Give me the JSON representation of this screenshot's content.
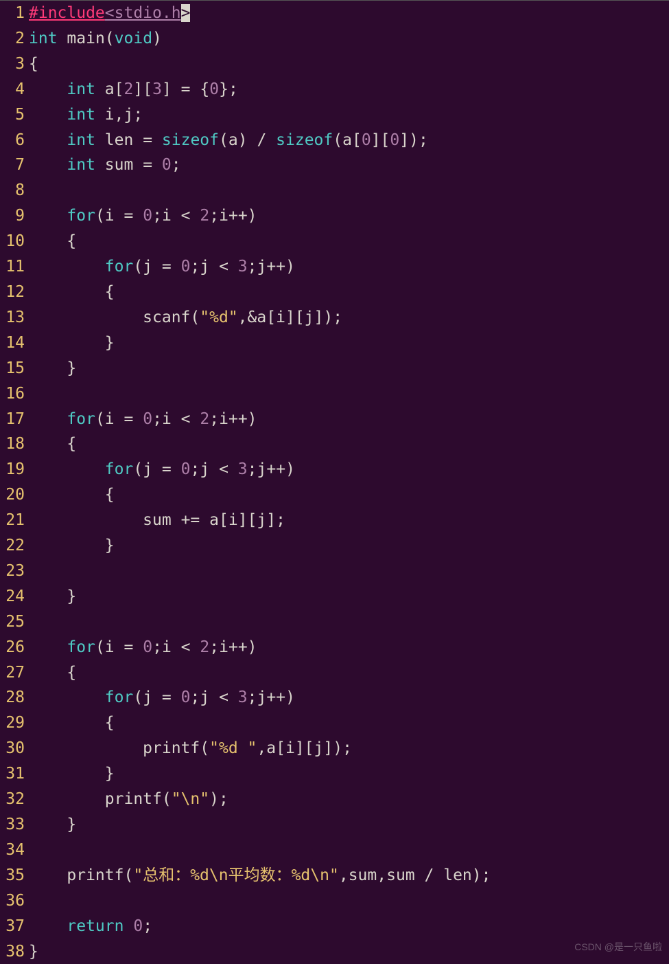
{
  "watermark": "CSDN @是一只鱼啦",
  "lines": [
    {
      "n": "1",
      "tokens": [
        [
          "pp",
          "#include"
        ],
        [
          "inc",
          "<stdio.h"
        ],
        [
          "cursor",
          ">"
        ]
      ]
    },
    {
      "n": "2",
      "tokens": [
        [
          "kw",
          "int"
        ],
        [
          "sp",
          " "
        ],
        [
          "id",
          "main"
        ],
        [
          "paren",
          "("
        ],
        [
          "kw",
          "void"
        ],
        [
          "paren",
          ")"
        ]
      ]
    },
    {
      "n": "3",
      "tokens": [
        [
          "paren",
          "{"
        ]
      ]
    },
    {
      "n": "4",
      "tokens": [
        [
          "indent",
          "    "
        ],
        [
          "kw",
          "int"
        ],
        [
          "sp",
          " "
        ],
        [
          "id",
          "a"
        ],
        [
          "paren",
          "["
        ],
        [
          "num",
          "2"
        ],
        [
          "paren",
          "]["
        ],
        [
          "num",
          "3"
        ],
        [
          "paren",
          "]"
        ],
        [
          "sp",
          " "
        ],
        [
          "op",
          "="
        ],
        [
          "sp",
          " "
        ],
        [
          "paren",
          "{"
        ],
        [
          "num",
          "0"
        ],
        [
          "paren",
          "}"
        ],
        [
          "op",
          ";"
        ]
      ]
    },
    {
      "n": "5",
      "tokens": [
        [
          "indent",
          "    "
        ],
        [
          "kw",
          "int"
        ],
        [
          "sp",
          " "
        ],
        [
          "id",
          "i"
        ],
        [
          "op",
          ","
        ],
        [
          "id",
          "j"
        ],
        [
          "op",
          ";"
        ]
      ]
    },
    {
      "n": "6",
      "tokens": [
        [
          "indent",
          "    "
        ],
        [
          "kw",
          "int"
        ],
        [
          "sp",
          " "
        ],
        [
          "id",
          "len"
        ],
        [
          "sp",
          " "
        ],
        [
          "op",
          "="
        ],
        [
          "sp",
          " "
        ],
        [
          "kw",
          "sizeof"
        ],
        [
          "paren",
          "("
        ],
        [
          "id",
          "a"
        ],
        [
          "paren",
          ")"
        ],
        [
          "sp",
          " "
        ],
        [
          "op",
          "/"
        ],
        [
          "sp",
          " "
        ],
        [
          "kw",
          "sizeof"
        ],
        [
          "paren",
          "("
        ],
        [
          "id",
          "a"
        ],
        [
          "paren",
          "["
        ],
        [
          "num",
          "0"
        ],
        [
          "paren",
          "]["
        ],
        [
          "num",
          "0"
        ],
        [
          "paren",
          "])"
        ],
        [
          "op",
          ";"
        ]
      ]
    },
    {
      "n": "7",
      "tokens": [
        [
          "indent",
          "    "
        ],
        [
          "kw",
          "int"
        ],
        [
          "sp",
          " "
        ],
        [
          "id",
          "sum"
        ],
        [
          "sp",
          " "
        ],
        [
          "op",
          "="
        ],
        [
          "sp",
          " "
        ],
        [
          "num",
          "0"
        ],
        [
          "op",
          ";"
        ]
      ]
    },
    {
      "n": "8",
      "tokens": []
    },
    {
      "n": "9",
      "tokens": [
        [
          "indent",
          "    "
        ],
        [
          "kw",
          "for"
        ],
        [
          "paren",
          "("
        ],
        [
          "id",
          "i"
        ],
        [
          "sp",
          " "
        ],
        [
          "op",
          "="
        ],
        [
          "sp",
          " "
        ],
        [
          "num",
          "0"
        ],
        [
          "op",
          ";"
        ],
        [
          "id",
          "i"
        ],
        [
          "sp",
          " "
        ],
        [
          "op",
          "<"
        ],
        [
          "sp",
          " "
        ],
        [
          "num",
          "2"
        ],
        [
          "op",
          ";"
        ],
        [
          "id",
          "i"
        ],
        [
          "op",
          "++"
        ],
        [
          "paren",
          ")"
        ]
      ]
    },
    {
      "n": "10",
      "tokens": [
        [
          "indent",
          "    "
        ],
        [
          "paren",
          "{"
        ]
      ]
    },
    {
      "n": "11",
      "tokens": [
        [
          "indent",
          "        "
        ],
        [
          "kw",
          "for"
        ],
        [
          "paren",
          "("
        ],
        [
          "id",
          "j"
        ],
        [
          "sp",
          " "
        ],
        [
          "op",
          "="
        ],
        [
          "sp",
          " "
        ],
        [
          "num",
          "0"
        ],
        [
          "op",
          ";"
        ],
        [
          "id",
          "j"
        ],
        [
          "sp",
          " "
        ],
        [
          "op",
          "<"
        ],
        [
          "sp",
          " "
        ],
        [
          "num",
          "3"
        ],
        [
          "op",
          ";"
        ],
        [
          "id",
          "j"
        ],
        [
          "op",
          "++"
        ],
        [
          "paren",
          ")"
        ]
      ]
    },
    {
      "n": "12",
      "tokens": [
        [
          "indent",
          "        "
        ],
        [
          "paren",
          "{"
        ]
      ]
    },
    {
      "n": "13",
      "tokens": [
        [
          "indent",
          "            "
        ],
        [
          "id",
          "scanf"
        ],
        [
          "paren",
          "("
        ],
        [
          "str",
          "\"%d\""
        ],
        [
          "op",
          ","
        ],
        [
          "op",
          "&"
        ],
        [
          "id",
          "a"
        ],
        [
          "paren",
          "["
        ],
        [
          "id",
          "i"
        ],
        [
          "paren",
          "]["
        ],
        [
          "id",
          "j"
        ],
        [
          "paren",
          "])"
        ],
        [
          "op",
          ";"
        ]
      ]
    },
    {
      "n": "14",
      "tokens": [
        [
          "indent",
          "        "
        ],
        [
          "paren",
          "}"
        ]
      ]
    },
    {
      "n": "15",
      "tokens": [
        [
          "indent",
          "    "
        ],
        [
          "paren",
          "}"
        ]
      ]
    },
    {
      "n": "16",
      "tokens": []
    },
    {
      "n": "17",
      "tokens": [
        [
          "indent",
          "    "
        ],
        [
          "kw",
          "for"
        ],
        [
          "paren",
          "("
        ],
        [
          "id",
          "i"
        ],
        [
          "sp",
          " "
        ],
        [
          "op",
          "="
        ],
        [
          "sp",
          " "
        ],
        [
          "num",
          "0"
        ],
        [
          "op",
          ";"
        ],
        [
          "id",
          "i"
        ],
        [
          "sp",
          " "
        ],
        [
          "op",
          "<"
        ],
        [
          "sp",
          " "
        ],
        [
          "num",
          "2"
        ],
        [
          "op",
          ";"
        ],
        [
          "id",
          "i"
        ],
        [
          "op",
          "++"
        ],
        [
          "paren",
          ")"
        ]
      ]
    },
    {
      "n": "18",
      "tokens": [
        [
          "indent",
          "    "
        ],
        [
          "paren",
          "{"
        ]
      ]
    },
    {
      "n": "19",
      "tokens": [
        [
          "indent",
          "        "
        ],
        [
          "kw",
          "for"
        ],
        [
          "paren",
          "("
        ],
        [
          "id",
          "j"
        ],
        [
          "sp",
          " "
        ],
        [
          "op",
          "="
        ],
        [
          "sp",
          " "
        ],
        [
          "num",
          "0"
        ],
        [
          "op",
          ";"
        ],
        [
          "id",
          "j"
        ],
        [
          "sp",
          " "
        ],
        [
          "op",
          "<"
        ],
        [
          "sp",
          " "
        ],
        [
          "num",
          "3"
        ],
        [
          "op",
          ";"
        ],
        [
          "id",
          "j"
        ],
        [
          "op",
          "++"
        ],
        [
          "paren",
          ")"
        ]
      ]
    },
    {
      "n": "20",
      "tokens": [
        [
          "indent",
          "        "
        ],
        [
          "paren",
          "{"
        ]
      ]
    },
    {
      "n": "21",
      "tokens": [
        [
          "indent",
          "            "
        ],
        [
          "id",
          "sum"
        ],
        [
          "sp",
          " "
        ],
        [
          "op",
          "+="
        ],
        [
          "sp",
          " "
        ],
        [
          "id",
          "a"
        ],
        [
          "paren",
          "["
        ],
        [
          "id",
          "i"
        ],
        [
          "paren",
          "]["
        ],
        [
          "id",
          "j"
        ],
        [
          "paren",
          "]"
        ],
        [
          "op",
          ";"
        ]
      ]
    },
    {
      "n": "22",
      "tokens": [
        [
          "indent",
          "        "
        ],
        [
          "paren",
          "}"
        ]
      ]
    },
    {
      "n": "23",
      "tokens": []
    },
    {
      "n": "24",
      "tokens": [
        [
          "indent",
          "    "
        ],
        [
          "paren",
          "}"
        ]
      ]
    },
    {
      "n": "25",
      "tokens": []
    },
    {
      "n": "26",
      "tokens": [
        [
          "indent",
          "    "
        ],
        [
          "kw",
          "for"
        ],
        [
          "paren",
          "("
        ],
        [
          "id",
          "i"
        ],
        [
          "sp",
          " "
        ],
        [
          "op",
          "="
        ],
        [
          "sp",
          " "
        ],
        [
          "num",
          "0"
        ],
        [
          "op",
          ";"
        ],
        [
          "id",
          "i"
        ],
        [
          "sp",
          " "
        ],
        [
          "op",
          "<"
        ],
        [
          "sp",
          " "
        ],
        [
          "num",
          "2"
        ],
        [
          "op",
          ";"
        ],
        [
          "id",
          "i"
        ],
        [
          "op",
          "++"
        ],
        [
          "paren",
          ")"
        ]
      ]
    },
    {
      "n": "27",
      "tokens": [
        [
          "indent",
          "    "
        ],
        [
          "paren",
          "{"
        ]
      ]
    },
    {
      "n": "28",
      "tokens": [
        [
          "indent",
          "        "
        ],
        [
          "kw",
          "for"
        ],
        [
          "paren",
          "("
        ],
        [
          "id",
          "j"
        ],
        [
          "sp",
          " "
        ],
        [
          "op",
          "="
        ],
        [
          "sp",
          " "
        ],
        [
          "num",
          "0"
        ],
        [
          "op",
          ";"
        ],
        [
          "id",
          "j"
        ],
        [
          "sp",
          " "
        ],
        [
          "op",
          "<"
        ],
        [
          "sp",
          " "
        ],
        [
          "num",
          "3"
        ],
        [
          "op",
          ";"
        ],
        [
          "id",
          "j"
        ],
        [
          "op",
          "++"
        ],
        [
          "paren",
          ")"
        ]
      ]
    },
    {
      "n": "29",
      "tokens": [
        [
          "indent",
          "        "
        ],
        [
          "paren",
          "{"
        ]
      ]
    },
    {
      "n": "30",
      "tokens": [
        [
          "indent",
          "            "
        ],
        [
          "id",
          "printf"
        ],
        [
          "paren",
          "("
        ],
        [
          "str",
          "\"%d \""
        ],
        [
          "op",
          ","
        ],
        [
          "id",
          "a"
        ],
        [
          "paren",
          "["
        ],
        [
          "id",
          "i"
        ],
        [
          "paren",
          "]["
        ],
        [
          "id",
          "j"
        ],
        [
          "paren",
          "])"
        ],
        [
          "op",
          ";"
        ]
      ]
    },
    {
      "n": "31",
      "tokens": [
        [
          "indent",
          "        "
        ],
        [
          "paren",
          "}"
        ]
      ]
    },
    {
      "n": "32",
      "tokens": [
        [
          "indent",
          "        "
        ],
        [
          "id",
          "printf"
        ],
        [
          "paren",
          "("
        ],
        [
          "str",
          "\"\\n\""
        ],
        [
          "paren",
          ")"
        ],
        [
          "op",
          ";"
        ]
      ]
    },
    {
      "n": "33",
      "tokens": [
        [
          "indent",
          "    "
        ],
        [
          "paren",
          "}"
        ]
      ]
    },
    {
      "n": "34",
      "tokens": []
    },
    {
      "n": "35",
      "tokens": [
        [
          "indent",
          "    "
        ],
        [
          "id",
          "printf"
        ],
        [
          "paren",
          "("
        ],
        [
          "str",
          "\"总和：%d\\n平均数：%d\\n\""
        ],
        [
          "op",
          ","
        ],
        [
          "id",
          "sum"
        ],
        [
          "op",
          ","
        ],
        [
          "id",
          "sum"
        ],
        [
          "sp",
          " "
        ],
        [
          "op",
          "/"
        ],
        [
          "sp",
          " "
        ],
        [
          "id",
          "len"
        ],
        [
          "paren",
          ")"
        ],
        [
          "op",
          ";"
        ]
      ]
    },
    {
      "n": "36",
      "tokens": []
    },
    {
      "n": "37",
      "tokens": [
        [
          "indent",
          "    "
        ],
        [
          "kw",
          "return"
        ],
        [
          "sp",
          " "
        ],
        [
          "num",
          "0"
        ],
        [
          "op",
          ";"
        ]
      ]
    },
    {
      "n": "38",
      "tokens": [
        [
          "paren",
          "}"
        ]
      ]
    }
  ]
}
